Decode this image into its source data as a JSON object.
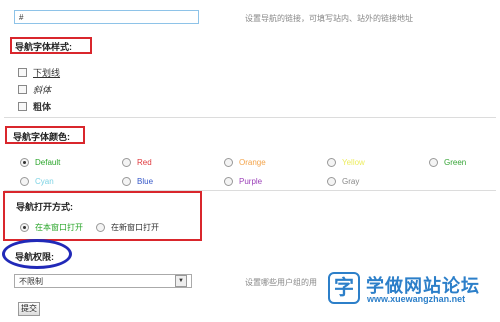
{
  "link_field": {
    "value": "#",
    "hint": "设置导航的链接，可填写站内、站外的链接地址"
  },
  "font_style": {
    "title": "导航字体样式:",
    "options": [
      {
        "label": "下划线",
        "checked": false
      },
      {
        "label": "斜体",
        "checked": false
      },
      {
        "label": "粗体",
        "checked": false
      }
    ]
  },
  "font_color": {
    "title": "导航字体颜色:",
    "selected": "Default",
    "options": [
      {
        "label": "Default",
        "color": "#2aa52a"
      },
      {
        "label": "Red",
        "color": "#e0393e"
      },
      {
        "label": "Orange",
        "color": "#f3a34a"
      },
      {
        "label": "Yellow",
        "color": "#eded60"
      },
      {
        "label": "Green",
        "color": "#37a537"
      },
      {
        "label": "Cyan",
        "color": "#7dd3e4"
      },
      {
        "label": "Blue",
        "color": "#3557c8"
      },
      {
        "label": "Purple",
        "color": "#9b3fb8"
      },
      {
        "label": "Gray",
        "color": "#888888"
      }
    ]
  },
  "open_mode": {
    "title": "导航打开方式:",
    "options": [
      {
        "label": "在本窗口打开",
        "checked": true,
        "color": "#2aa52a"
      },
      {
        "label": "在新窗口打开",
        "checked": false,
        "color": "#333333"
      }
    ]
  },
  "permission": {
    "title": "导航权限:",
    "selected_value": "不限制",
    "hint": "设置哪些用户组的用"
  },
  "submit_label": "提交",
  "watermark": {
    "icon_char": "字",
    "name": "学做网站论坛",
    "url": "www.xuewangzhan.net"
  },
  "colors": {
    "highlight_box": "#d9262c",
    "highlight_oval": "#2129b8",
    "input_border": "#8ec3e8"
  }
}
